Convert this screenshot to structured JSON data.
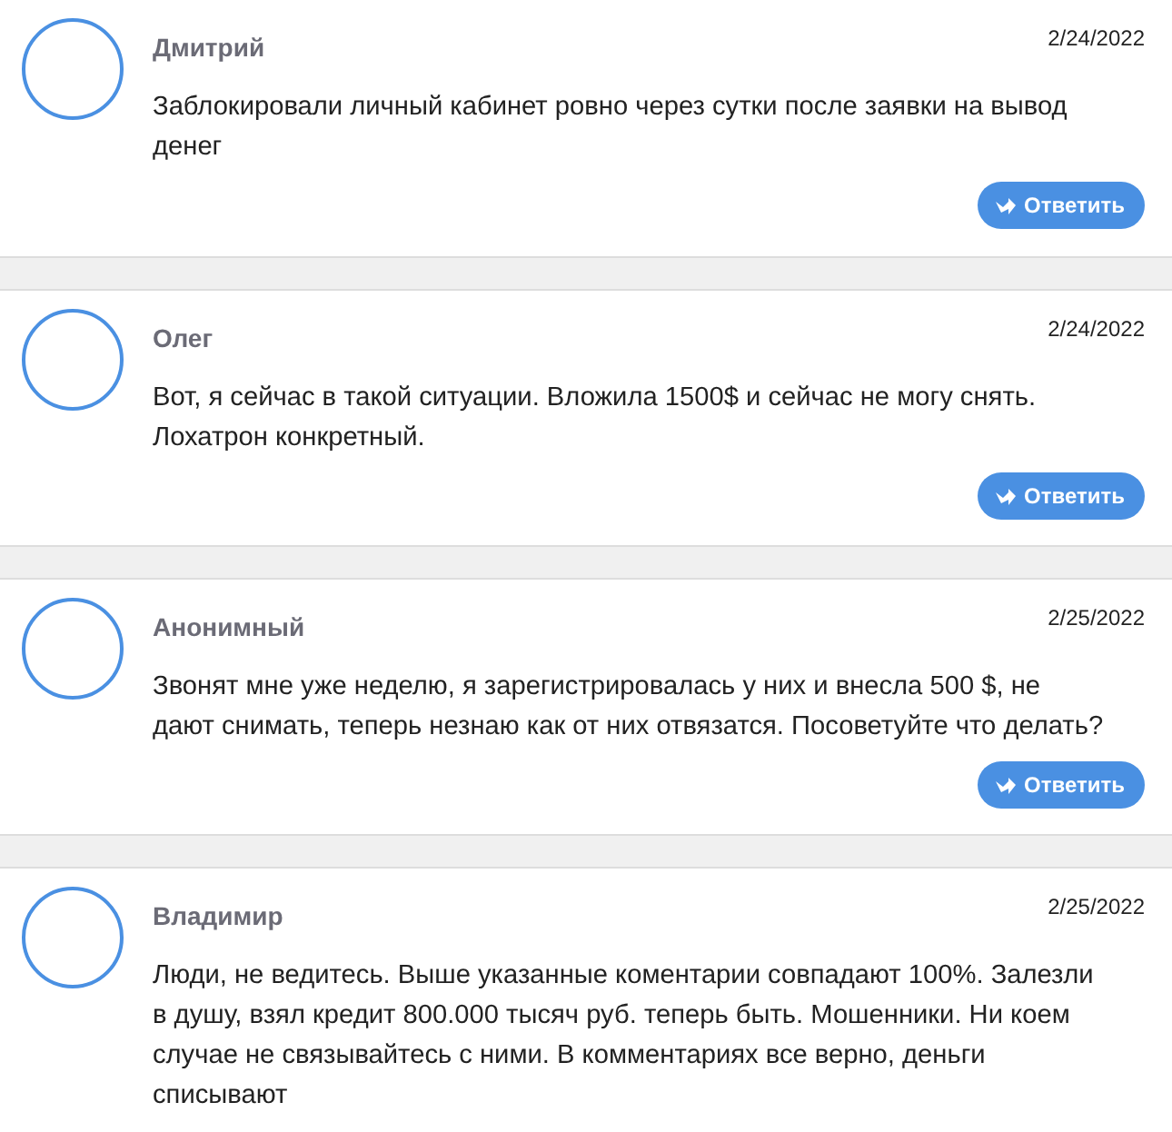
{
  "comments": [
    {
      "author": "Дмитрий",
      "date": "2/24/2022",
      "text": "Заблокировали личный кабинет ровно через сутки после заявки на вывод денег",
      "reply_button": "Ответить"
    },
    {
      "author": "Олег",
      "date": "2/24/2022",
      "text": "Вот, я сейчас в такой ситуации. Вложила 1500$ и сейчас не могу снять. Лохатрон конкретный.",
      "reply_button": "Ответить"
    },
    {
      "author": "Анонимный",
      "date": "2/25/2022",
      "text": "Звонят мне уже неделю, я зарегистрировалась у них и внесла 500 $, не дают снимать, теперь незнаю как от них отвязатся. Посоветуйте что делать?",
      "reply_button": "Ответить"
    },
    {
      "author": "Владимир",
      "date": "2/25/2022",
      "text": "Люди, не ведитесь. Выше указанные коментарии совпадают 100%. Залезли в душу, взял кредит 800.000 тысяч руб. теперь быть. Мошенники. Ни коем случае не связывайтесь с ними. В комментариях все верно, деньги списывают"
    }
  ]
}
